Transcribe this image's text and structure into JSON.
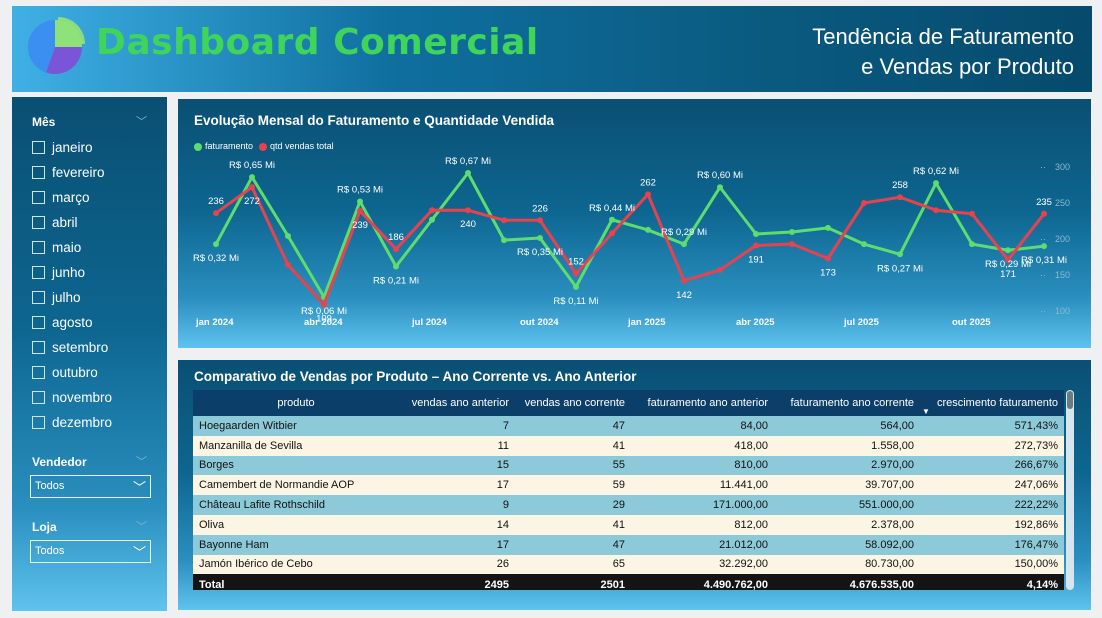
{
  "header": {
    "title": "Dashboard Comercial",
    "subtitle_line1": "Tendência de Faturamento",
    "subtitle_line2": "e Vendas por Produto"
  },
  "sidebar": {
    "month_label": "Mês",
    "months": [
      "janeiro",
      "fevereiro",
      "março",
      "abril",
      "maio",
      "junho",
      "julho",
      "agosto",
      "setembro",
      "outubro",
      "novembro",
      "dezembro"
    ],
    "seller_label": "Vendedor",
    "seller_value": "Todos",
    "store_label": "Loja",
    "store_value": "Todos"
  },
  "colors": {
    "faturamento": "#5fdc6e",
    "qtd": "#e8424f",
    "title_green": "#3fd45a"
  },
  "chart_data": {
    "type": "line",
    "title": "Evolução Mensal do Faturamento e Quantidade Vendida",
    "x_ticks": [
      "jan 2024",
      "abr 2024",
      "jul 2024",
      "out 2024",
      "jan 2025",
      "abr 2025",
      "jul 2025",
      "out 2025"
    ],
    "y_right_ticks": [
      "300",
      "250",
      "200",
      "150",
      "100"
    ],
    "y_right_range": [
      100,
      300
    ],
    "grid": false,
    "legend_position": "top-left",
    "series": [
      {
        "name": "faturamento",
        "axis": "left",
        "values": [
          0.32,
          0.65,
          0.36,
          0.06,
          0.53,
          0.21,
          0.44,
          0.67,
          0.34,
          0.35,
          0.11,
          0.44,
          0.39,
          0.32,
          0.6,
          0.37,
          0.38,
          0.4,
          0.32,
          0.27,
          0.62,
          0.32,
          0.29,
          0.31
        ],
        "labels": [
          "R$ 0,32 Mi",
          "R$ 0,65 Mi",
          "",
          "R$ 0,06 Mi",
          "R$ 0,53 Mi",
          "R$ 0,21 Mi",
          "",
          "R$ 0,67 Mi",
          "",
          "R$ 0,35 Mi",
          "R$ 0,11 Mi",
          "R$ 0,44 Mi",
          "",
          "R$ 0,29 Mi",
          "R$ 0,60 Mi",
          "",
          "",
          "",
          "",
          "R$ 0,27 Mi",
          "R$ 0,62 Mi",
          "",
          "R$ 0,29 Mi",
          "R$ 0,31 Mi"
        ]
      },
      {
        "name": "qtd vendas total",
        "axis": "right",
        "values": [
          236,
          272,
          164,
          109,
          239,
          186,
          240,
          240,
          226,
          226,
          152,
          208,
          262,
          142,
          157,
          191,
          193,
          173,
          250,
          258,
          240,
          235,
          171,
          235
        ],
        "labels": [
          "236",
          "272",
          "",
          "109",
          "239",
          "186",
          "",
          "240",
          "",
          "226",
          "152",
          "",
          "262",
          "142",
          "",
          "191",
          "",
          "173",
          "",
          "258",
          "",
          "",
          "171",
          "235"
        ]
      }
    ]
  },
  "table": {
    "title": "Comparativo de Vendas por Produto – Ano Corrente vs. Ano Anterior",
    "columns": [
      "produto",
      "vendas ano anterior",
      "vendas ano corrente",
      "faturamento ano anterior",
      "faturamento ano corrente",
      "crescimento faturamento"
    ],
    "rows": [
      [
        "Hoegaarden Witbier",
        "7",
        "47",
        "84,00",
        "564,00",
        "571,43%"
      ],
      [
        "Manzanilla de Sevilla",
        "11",
        "41",
        "418,00",
        "1.558,00",
        "272,73%"
      ],
      [
        "Borges",
        "15",
        "55",
        "810,00",
        "2.970,00",
        "266,67%"
      ],
      [
        "Camembert de Normandie AOP",
        "17",
        "59",
        "11.441,00",
        "39.707,00",
        "247,06%"
      ],
      [
        "Château Lafite Rothschild",
        "9",
        "29",
        "171.000,00",
        "551.000,00",
        "222,22%"
      ],
      [
        "Oliva",
        "14",
        "41",
        "812,00",
        "2.378,00",
        "192,86%"
      ],
      [
        "Bayonne Ham",
        "17",
        "47",
        "21.012,00",
        "58.092,00",
        "176,47%"
      ],
      [
        "Jamón Ibérico de Cebo",
        "26",
        "65",
        "32.292,00",
        "80.730,00",
        "150,00%"
      ]
    ],
    "total": [
      "Total",
      "2495",
      "2501",
      "4.490.762,00",
      "4.676.535,00",
      "4,14%"
    ]
  }
}
